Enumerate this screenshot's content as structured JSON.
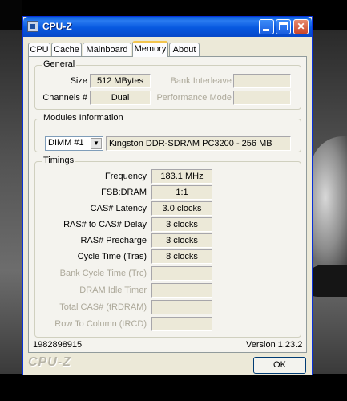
{
  "window": {
    "title": "CPU-Z"
  },
  "tabs": [
    "CPU",
    "Cache",
    "Mainboard",
    "Memory",
    "About"
  ],
  "active_tab": "Memory",
  "general": {
    "legend": "General",
    "size_label": "Size",
    "size_value": "512 MBytes",
    "channels_label": "Channels #",
    "channels_value": "Dual",
    "bank_interleave_label": "Bank Interleave",
    "performance_mode_label": "Performance Mode"
  },
  "modules": {
    "legend": "Modules Information",
    "slot_selected": "DIMM #1",
    "module_value": "Kingston DDR-SDRAM PC3200 - 256 MB"
  },
  "timings": {
    "legend": "Timings",
    "rows": [
      {
        "label": "Frequency",
        "value": "183.1 MHz",
        "enabled": true
      },
      {
        "label": "FSB:DRAM",
        "value": "1:1",
        "enabled": true
      },
      {
        "label": "CAS# Latency",
        "value": "3.0 clocks",
        "enabled": true
      },
      {
        "label": "RAS# to CAS# Delay",
        "value": "3 clocks",
        "enabled": true
      },
      {
        "label": "RAS# Precharge",
        "value": "3 clocks",
        "enabled": true
      },
      {
        "label": "Cycle Time (Tras)",
        "value": "8 clocks",
        "enabled": true
      },
      {
        "label": "Bank Cycle Time (Trc)",
        "value": "",
        "enabled": false
      },
      {
        "label": "DRAM Idle Timer",
        "value": "",
        "enabled": false
      },
      {
        "label": "Total CAS# (tRDRAM)",
        "value": "",
        "enabled": false
      },
      {
        "label": "Row To Column (tRCD)",
        "value": "",
        "enabled": false
      }
    ]
  },
  "footer": {
    "serial": "1982898915",
    "version": "Version 1.23.2",
    "brand": "CPU-Z",
    "ok_label": "OK"
  }
}
